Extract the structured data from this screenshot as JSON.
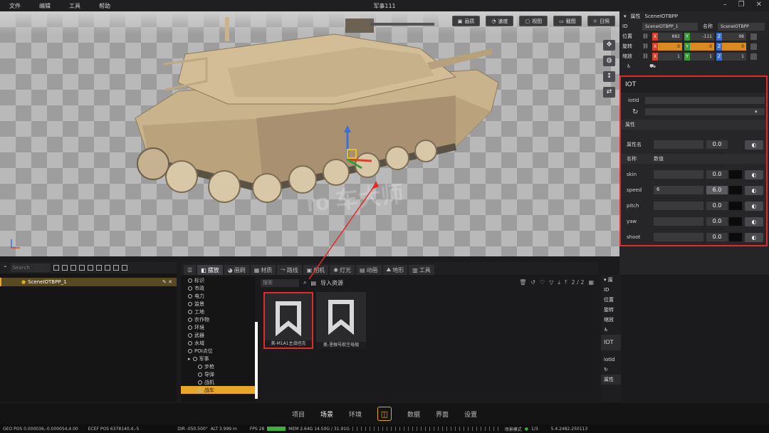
{
  "titlebar": {
    "menu": [
      "文件",
      "编辑",
      "工具",
      "帮助"
    ],
    "title": "军事111"
  },
  "viewport": {
    "buttons": [
      "画质",
      "速度",
      "视图",
      "截图",
      "日照"
    ],
    "watermark": "ro 车大师"
  },
  "props": {
    "header_label": "属性",
    "object_name": "SceneIOTBPP",
    "id_label": "ID",
    "id_value": "SceneIOTBPP_1",
    "name_label": "名称",
    "name_value": "SceneIOTBPP",
    "transform": [
      {
        "label": "位置",
        "x": "882",
        "y": "-111",
        "z": "98"
      },
      {
        "label": "旋转",
        "x": "0",
        "y": "0",
        "z": "0"
      },
      {
        "label": "缩放",
        "x": "1",
        "y": "1",
        "z": "1"
      }
    ]
  },
  "iot": {
    "title": "IOT",
    "iotid_label": "iotId",
    "section_attr": "属性",
    "attr_name_label": "属性名",
    "attr_name_value": "0.0",
    "col_name": "名称",
    "col_value": "数值",
    "rows": [
      {
        "name": "skin",
        "field": "",
        "value": "0.0"
      },
      {
        "name": "speed",
        "field": "6",
        "value": "6.0"
      },
      {
        "name": "pitch",
        "field": "",
        "value": "0.0"
      },
      {
        "name": "yaw",
        "field": "",
        "value": "0.0"
      },
      {
        "name": "shoot",
        "field": "",
        "value": "0.0"
      }
    ]
  },
  "outliner": {
    "search_placeholder": "Search",
    "selected_item": "SceneIOTBPP_1"
  },
  "assets": {
    "tabs": [
      "摆放",
      "画刷",
      "材质",
      "路线",
      "相机",
      "灯光",
      "动画",
      "地形",
      "工具"
    ],
    "search_placeholder": "搜索",
    "import_label": "导入资源",
    "page": "2 / 2",
    "tree": [
      "标识",
      "市政",
      "电力",
      "监景",
      "工地",
      "农作物",
      "环境",
      "武器",
      "水域",
      "POI点位",
      "军事",
      "步枪",
      "导弹",
      "战机",
      "战车"
    ],
    "cards": [
      "美-M1A1主战坦克",
      "美-里根号航空母舰"
    ]
  },
  "mini": {
    "labels": [
      "ID",
      "位置",
      "旋转",
      "缩放"
    ],
    "iot": "IOT",
    "iotid": "iotId",
    "attr": "属性"
  },
  "nav": {
    "items": [
      "项目",
      "场景",
      "环境",
      "数据",
      "界面",
      "设置"
    ],
    "active": "场景"
  },
  "status": {
    "geo": "GEO POS  0.000036,-0.000054,4.00",
    "ecef": "ECEF POS  6378140,4,-5",
    "dir": "DIR  -050.500°",
    "alt": "ALT  3.999 m",
    "fps": "FPS  28",
    "mem": "MEM  2.64G  14.50G / 31.91G",
    "mode": "场景模式",
    "pages": "1/3",
    "version": "5.4.2482.250113"
  },
  "colors": {
    "accent": "#e6a62a",
    "highlight_box": "#e12b2b",
    "axis_x": "#d9402b",
    "axis_y": "#e6c02a",
    "axis_z": "#3a6fd8"
  }
}
